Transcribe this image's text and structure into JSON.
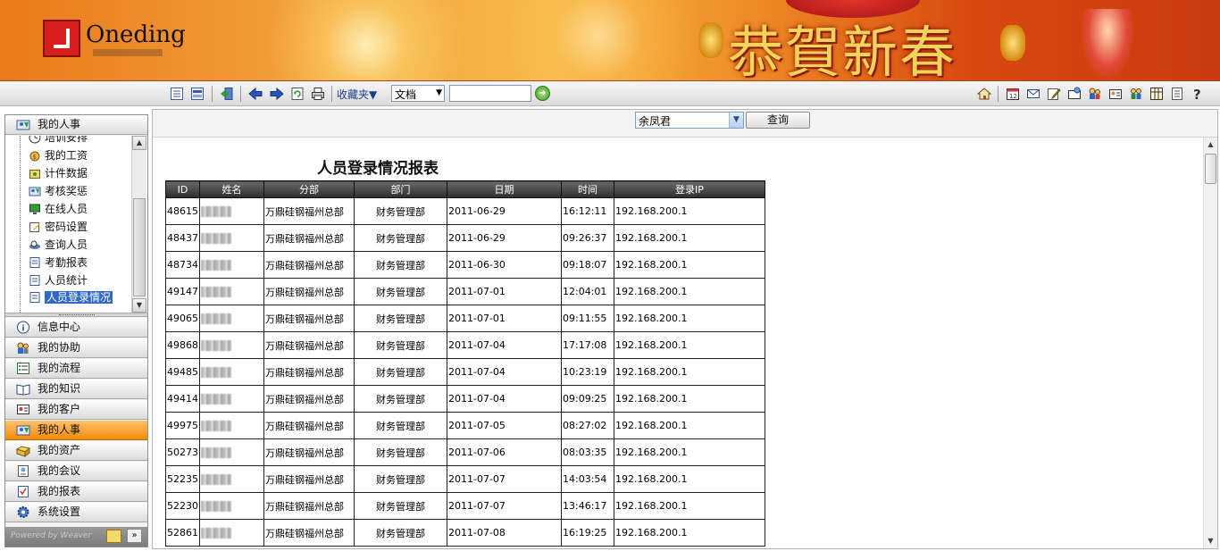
{
  "banner": {
    "brand": "Oneding",
    "festive_text": "恭賀新春"
  },
  "toolbar": {
    "favorites_label": "收藏夹▼",
    "doc_select": "文档",
    "search_value": "",
    "icons_left": [
      "list-icon",
      "layout-icon",
      "exit-icon",
      "back-arrow-icon",
      "forward-arrow-icon",
      "refresh-icon",
      "print-icon"
    ],
    "icons_right": [
      "home-icon",
      "calendar-icon",
      "mail-icon",
      "edit-icon",
      "message-icon",
      "users-icon",
      "id-card-icon",
      "org-icon",
      "grid-icon",
      "document-icon",
      "help-icon"
    ]
  },
  "sidebar": {
    "current_section": "我的人事",
    "tree_items": [
      "培训安排",
      "我的工资",
      "计件数据",
      "考核奖惩",
      "在线人员",
      "密码设置",
      "查询人员",
      "考勤报表",
      "人员统计",
      "人员登录情况"
    ],
    "selected_item": "人员登录情况",
    "sections": [
      "信息中心",
      "我的协助",
      "我的流程",
      "我的知识",
      "我的客户",
      "我的人事",
      "我的资产",
      "我的会议",
      "我的报表",
      "系统设置"
    ],
    "active_section": "我的人事",
    "footer_text": "Powered by Weaver"
  },
  "filter": {
    "user": "余凤君",
    "query_label": "查询"
  },
  "report": {
    "title": "人员登录情况报表",
    "columns": [
      "ID",
      "姓名",
      "分部",
      "部门",
      "日期",
      "时间",
      "登录IP"
    ],
    "rows": [
      [
        "48615",
        "",
        "万鼎硅钢福州总部",
        "财务管理部",
        "2011-06-29",
        "16:12:11",
        "192.168.200.1"
      ],
      [
        "48437",
        "",
        "万鼎硅钢福州总部",
        "财务管理部",
        "2011-06-29",
        "09:26:37",
        "192.168.200.1"
      ],
      [
        "48734",
        "",
        "万鼎硅钢福州总部",
        "财务管理部",
        "2011-06-30",
        "09:18:07",
        "192.168.200.1"
      ],
      [
        "49147",
        "",
        "万鼎硅钢福州总部",
        "财务管理部",
        "2011-07-01",
        "12:04:01",
        "192.168.200.1"
      ],
      [
        "49065",
        "",
        "万鼎硅钢福州总部",
        "财务管理部",
        "2011-07-01",
        "09:11:55",
        "192.168.200.1"
      ],
      [
        "49868",
        "",
        "万鼎硅钢福州总部",
        "财务管理部",
        "2011-07-04",
        "17:17:08",
        "192.168.200.1"
      ],
      [
        "49485",
        "",
        "万鼎硅钢福州总部",
        "财务管理部",
        "2011-07-04",
        "10:23:19",
        "192.168.200.1"
      ],
      [
        "49414",
        "",
        "万鼎硅钢福州总部",
        "财务管理部",
        "2011-07-04",
        "09:09:25",
        "192.168.200.1"
      ],
      [
        "49975",
        "",
        "万鼎硅钢福州总部",
        "财务管理部",
        "2011-07-05",
        "08:27:02",
        "192.168.200.1"
      ],
      [
        "50273",
        "",
        "万鼎硅钢福州总部",
        "财务管理部",
        "2011-07-06",
        "08:03:35",
        "192.168.200.1"
      ],
      [
        "52235",
        "",
        "万鼎硅钢福州总部",
        "财务管理部",
        "2011-07-07",
        "14:03:54",
        "192.168.200.1"
      ],
      [
        "52230",
        "",
        "万鼎硅钢福州总部",
        "财务管理部",
        "2011-07-07",
        "13:46:17",
        "192.168.200.1"
      ],
      [
        "52861",
        "",
        "万鼎硅钢福州总部",
        "财务管理部",
        "2011-07-08",
        "16:19:25",
        "192.168.200.1"
      ]
    ]
  },
  "colors": {
    "active_section": "#f08a0c",
    "selection": "#316ac5",
    "header_dark": "#2d2d2d"
  }
}
